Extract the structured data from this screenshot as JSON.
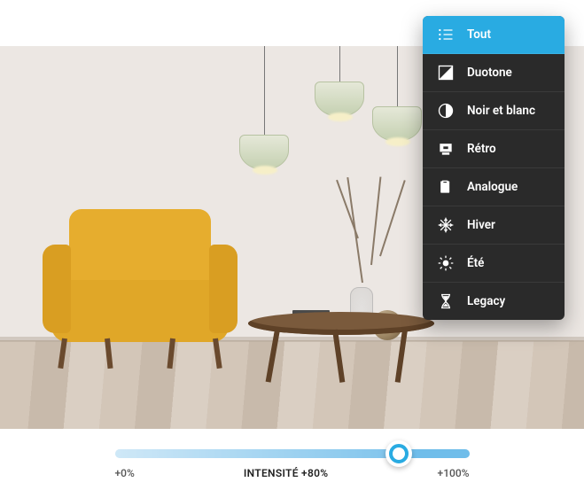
{
  "menu": {
    "items": [
      {
        "label": "Tout",
        "icon": "list-icon",
        "active": true
      },
      {
        "label": "Duotone",
        "icon": "duotone-icon",
        "active": false
      },
      {
        "label": "Noir et blanc",
        "icon": "contrast-icon",
        "active": false
      },
      {
        "label": "Rétro",
        "icon": "retro-icon",
        "active": false
      },
      {
        "label": "Analogue",
        "icon": "analogue-icon",
        "active": false
      },
      {
        "label": "Hiver",
        "icon": "snowflake-icon",
        "active": false
      },
      {
        "label": "Été",
        "icon": "sun-icon",
        "active": false
      },
      {
        "label": "Legacy",
        "icon": "hourglass-icon",
        "active": false
      }
    ]
  },
  "slider": {
    "min_label": "+0%",
    "max_label": "+100%",
    "center_label": "INTENSITÉ +80%",
    "value_percent": 80
  },
  "colors": {
    "accent": "#29abe2",
    "menu_bg": "#2a2a2a"
  }
}
